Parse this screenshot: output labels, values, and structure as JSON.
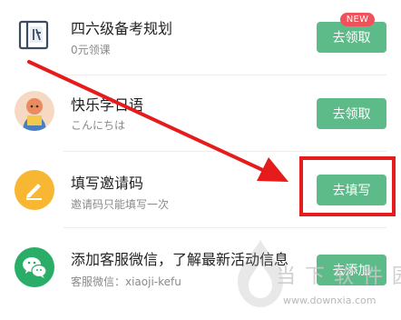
{
  "colors": {
    "button_green": "#5dbb8a",
    "badge_red": "#f0525b",
    "annotation_red": "#e61b1b",
    "pen_icon_yellow": "#f7b733",
    "wechat_green": "#2aae67"
  },
  "items": [
    {
      "icon": "book-icon",
      "title": "四六级备考规划",
      "subtitle": "0元领课",
      "button": "去领取",
      "badge": "NEW"
    },
    {
      "icon": "avatar-icon",
      "title": "快乐学日语",
      "subtitle": "こんにちは",
      "button": "去领取"
    },
    {
      "icon": "pen-icon",
      "title": "填写邀请码",
      "subtitle": "邀请码只能填写一次",
      "button": "去填写"
    },
    {
      "icon": "wechat-icon",
      "title": "添加客服微信，了解最新活动信息",
      "subtitle": "客服微信：xiaoji-kefu",
      "button": "去添加"
    }
  ],
  "watermark": {
    "text": "当下软件园",
    "url": "www.downxia.com"
  }
}
